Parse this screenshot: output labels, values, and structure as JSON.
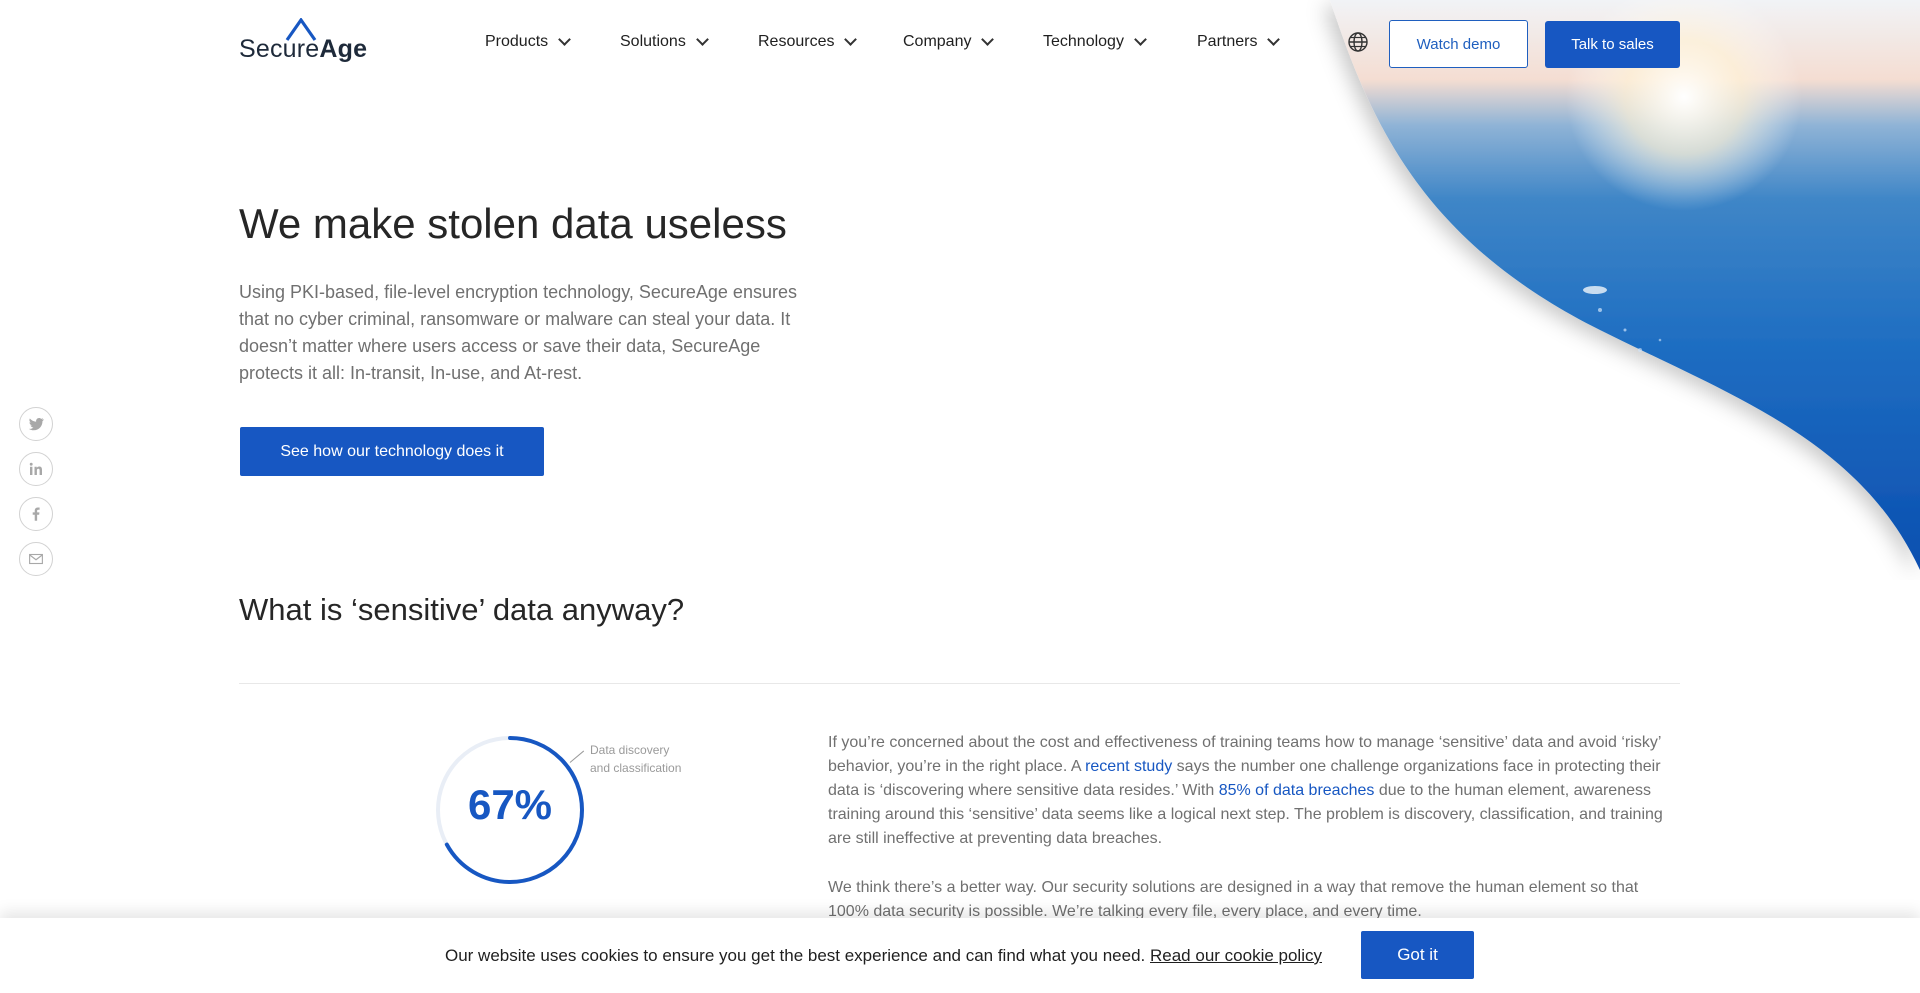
{
  "brand": {
    "name_part1": "Secure",
    "name_part2": "Age",
    "primary_color": "#1757c2"
  },
  "nav": {
    "items": [
      {
        "label": "Products"
      },
      {
        "label": "Solutions"
      },
      {
        "label": "Resources"
      },
      {
        "label": "Company"
      },
      {
        "label": "Technology"
      },
      {
        "label": "Partners"
      }
    ],
    "language_icon": "globe-icon",
    "watch_demo": "Watch demo",
    "talk_to_sales": "Talk to sales"
  },
  "hero": {
    "title": "We make stolen data useless",
    "description": "Using PKI-based, file-level encryption technology, SecureAge ensures that no cyber criminal, ransomware or malware can steal your data. It doesn’t matter where users access or save their data, SecureAge protects it all: In-transit, In-use, and At-rest.",
    "cta": "See how our technology does it"
  },
  "social": {
    "icons": [
      "twitter-icon",
      "linkedin-icon",
      "facebook-icon",
      "email-icon"
    ]
  },
  "section": {
    "title": "What is ‘sensitive’ data anyway?",
    "stat": {
      "value_text": "67%",
      "value": 67,
      "label_line1": "Data discovery",
      "label_line2": "and classification"
    },
    "paragraph1": {
      "part1": "If you’re concerned about the cost and effectiveness of training teams how to manage ‘sensitive’ data and avoid ‘risky’ behavior, you’re in the right place. A ",
      "link1": "recent study",
      "part2": " says the number one challenge organizations face in protecting their data is ‘discovering where sensitive data resides.’ With ",
      "link2": "85% of data breaches",
      "part3": " due to the human element, awareness training around this ‘sensitive’ data seems like a logical next step. The problem is discovery, classification, and training are still ineffective at preventing data breaches."
    },
    "paragraph2": "We think there’s a better way. Our security solutions are designed in a way that remove the human element so that 100% data security is possible. We’re talking every file, every place, and every time."
  },
  "cookie": {
    "text": "Our website uses cookies to ensure you get the best experience and can find what you need. ",
    "link": "Read our cookie policy",
    "button": "Got it"
  }
}
